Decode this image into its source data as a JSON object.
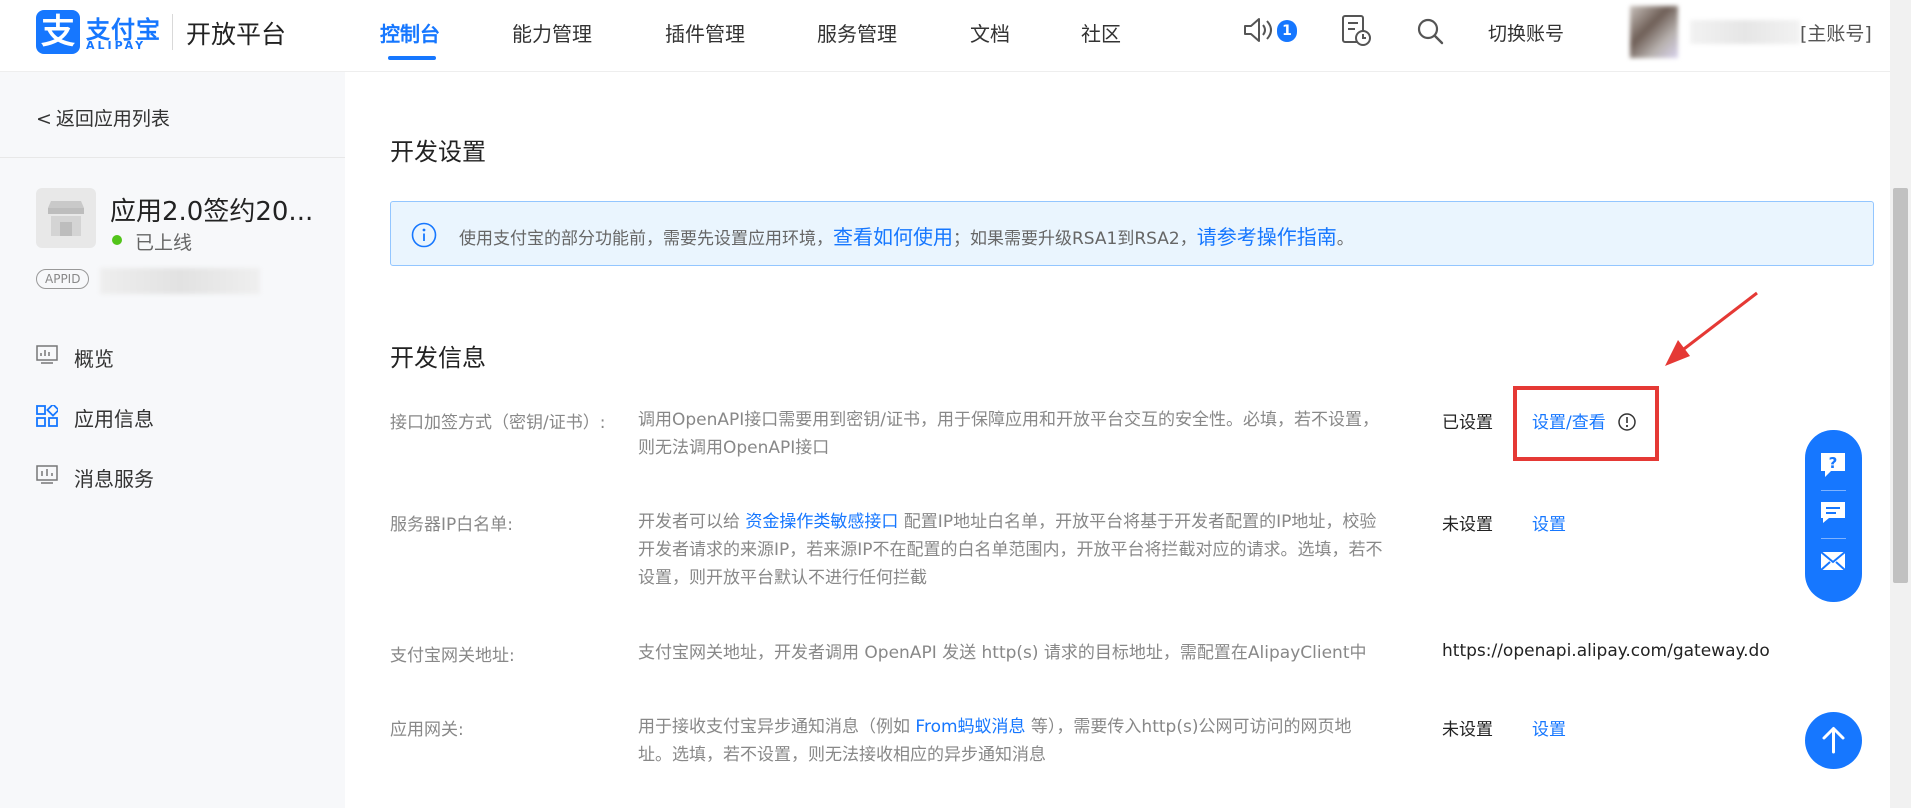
{
  "header": {
    "logo_cn": "支付宝",
    "logo_en": "ALIPAY",
    "platform_name": "开放平台",
    "nav": [
      {
        "label": "控制台",
        "active": true
      },
      {
        "label": "能力管理",
        "active": false
      },
      {
        "label": "插件管理",
        "active": false
      },
      {
        "label": "服务管理",
        "active": false
      },
      {
        "label": "文档",
        "active": false
      },
      {
        "label": "社区",
        "active": false
      }
    ],
    "notification_count": "1",
    "switch_account": "切换账号",
    "account_label": "[主账号]",
    "icons": [
      "speaker-icon",
      "ticket-clock-icon",
      "search-icon"
    ]
  },
  "sidebar": {
    "back": "返回应用列表",
    "app_name": "应用2.0签约20...",
    "app_status": "已上线",
    "appid_tag": "APPID",
    "menu": [
      {
        "label": "概览",
        "icon": "monitor-icon"
      },
      {
        "label": "应用信息",
        "icon": "grid-icon",
        "active": true
      },
      {
        "label": "消息服务",
        "icon": "chart-icon"
      }
    ]
  },
  "main": {
    "dev_settings_title": "开发设置",
    "alert": {
      "text1": "使用支付宝的部分功能前，需要先设置应用环境，",
      "link1": "查看如何使用",
      "text2": "；如果需要升级RSA1到RSA2，",
      "link2": "请参考操作指南",
      "text3": "。"
    },
    "dev_info_title": "开发信息",
    "rows": [
      {
        "label": "接口加签方式（密钥/证书）:",
        "desc_pre": "调用OpenAPI接口需要用到密钥/证书，用于保障应用和开放平台交互的安全性。必填，若不设置，则无法调用OpenAPI接口",
        "desc_link": "",
        "desc_post": "",
        "value": "已设置",
        "action": "设置/查看"
      },
      {
        "label": "服务器IP白名单:",
        "desc_pre": "开发者可以给 ",
        "desc_link": "资金操作类敏感接口",
        "desc_post": " 配置IP地址白名单，开放平台将基于开发者配置的IP地址，校验开发者请求的来源IP，若来源IP不在配置的白名单范围内，开放平台将拦截对应的请求。选填，若不设置，则开放平台默认不进行任何拦截",
        "value": "未设置",
        "action": "设置"
      },
      {
        "label": "支付宝网关地址:",
        "desc_pre": "支付宝网关地址，开发者调用 OpenAPI 发送 http(s) 请求的目标地址，需配置在AlipayClient中",
        "desc_link": "",
        "desc_post": "",
        "value": "https://openapi.alipay.com/gateway.do",
        "action": ""
      },
      {
        "label": "应用网关:",
        "desc_pre": "用于接收支付宝异步通知消息（例如 ",
        "desc_link": "From蚂蚁消息",
        "desc_post": " 等），需要传入http(s)公网可访问的网页地址。选填，若不设置，则无法接收相应的异步通知消息",
        "value": "未设置",
        "action": "设置"
      }
    ]
  },
  "colors": {
    "brand": "#1677ff",
    "highlight_red": "#e53935",
    "status_green": "#52c41a"
  }
}
